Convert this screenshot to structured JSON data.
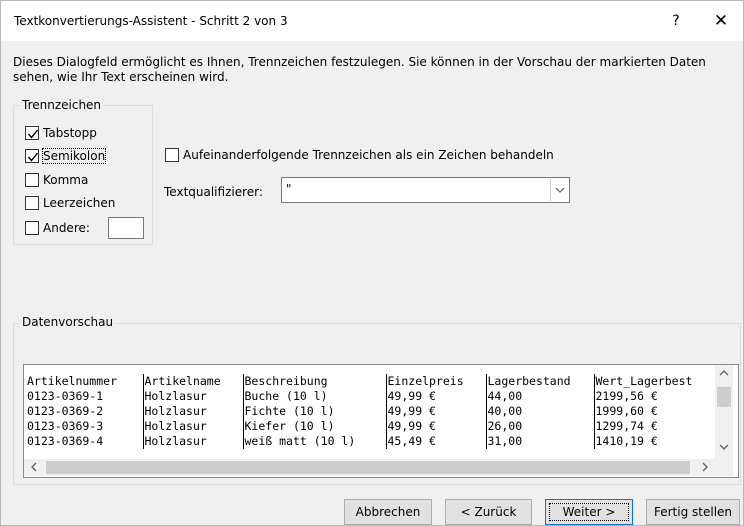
{
  "window": {
    "title": "Textkonvertierungs-Assistent - Schritt 2 von 3",
    "help_label": "?",
    "close_label": "✕"
  },
  "description": "Dieses Dialogfeld ermöglicht es Ihnen, Trennzeichen festzulegen. Sie können in der Vorschau der markierten Daten sehen, wie Ihr Text erscheinen wird.",
  "delimiters": {
    "legend": "Trennzeichen",
    "items": [
      {
        "label": "Tabstopp",
        "checked": true
      },
      {
        "label": "Semikolon",
        "checked": true
      },
      {
        "label": "Komma",
        "checked": false
      },
      {
        "label": "Leerzeichen",
        "checked": false
      },
      {
        "label": "Andere:",
        "checked": false
      }
    ],
    "other_value": ""
  },
  "consecutive": {
    "label": "Aufeinanderfolgende Trennzeichen als ein Zeichen behandeln",
    "checked": false
  },
  "text_qualifier": {
    "label": "Textqualifizierer:",
    "value": "\""
  },
  "preview": {
    "legend": "Datenvorschau",
    "columns": [
      "Artikelnummer",
      "Artikelname",
      "Beschreibung",
      "Einzelpreis",
      "Lagerbestand",
      "Wert_Lagerbest"
    ],
    "rows": [
      [
        "0123-0369-1",
        "Holzlasur",
        "Buche (10 l)",
        "49,99 €",
        "44,00",
        "2199,56 €"
      ],
      [
        "0123-0369-2",
        "Holzlasur",
        "Fichte (10 l)",
        "49,99 €",
        "40,00",
        "1999,60 €"
      ],
      [
        "0123-0369-3",
        "Holzlasur",
        "Kiefer (10 l)",
        "49,99 €",
        "26,00",
        "1299,74 €"
      ],
      [
        "0123-0369-4",
        "Holzlasur",
        "weiß matt (10 l)",
        "45,49 €",
        "31,00",
        "1410,19 €"
      ]
    ]
  },
  "buttons": {
    "cancel": "Abbrechen",
    "back": "< Zurück",
    "next": "Weiter >",
    "finish": "Fertig stellen"
  },
  "colors": {
    "accent": "#0078d7",
    "dialog_bg": "#f0f0f0"
  }
}
